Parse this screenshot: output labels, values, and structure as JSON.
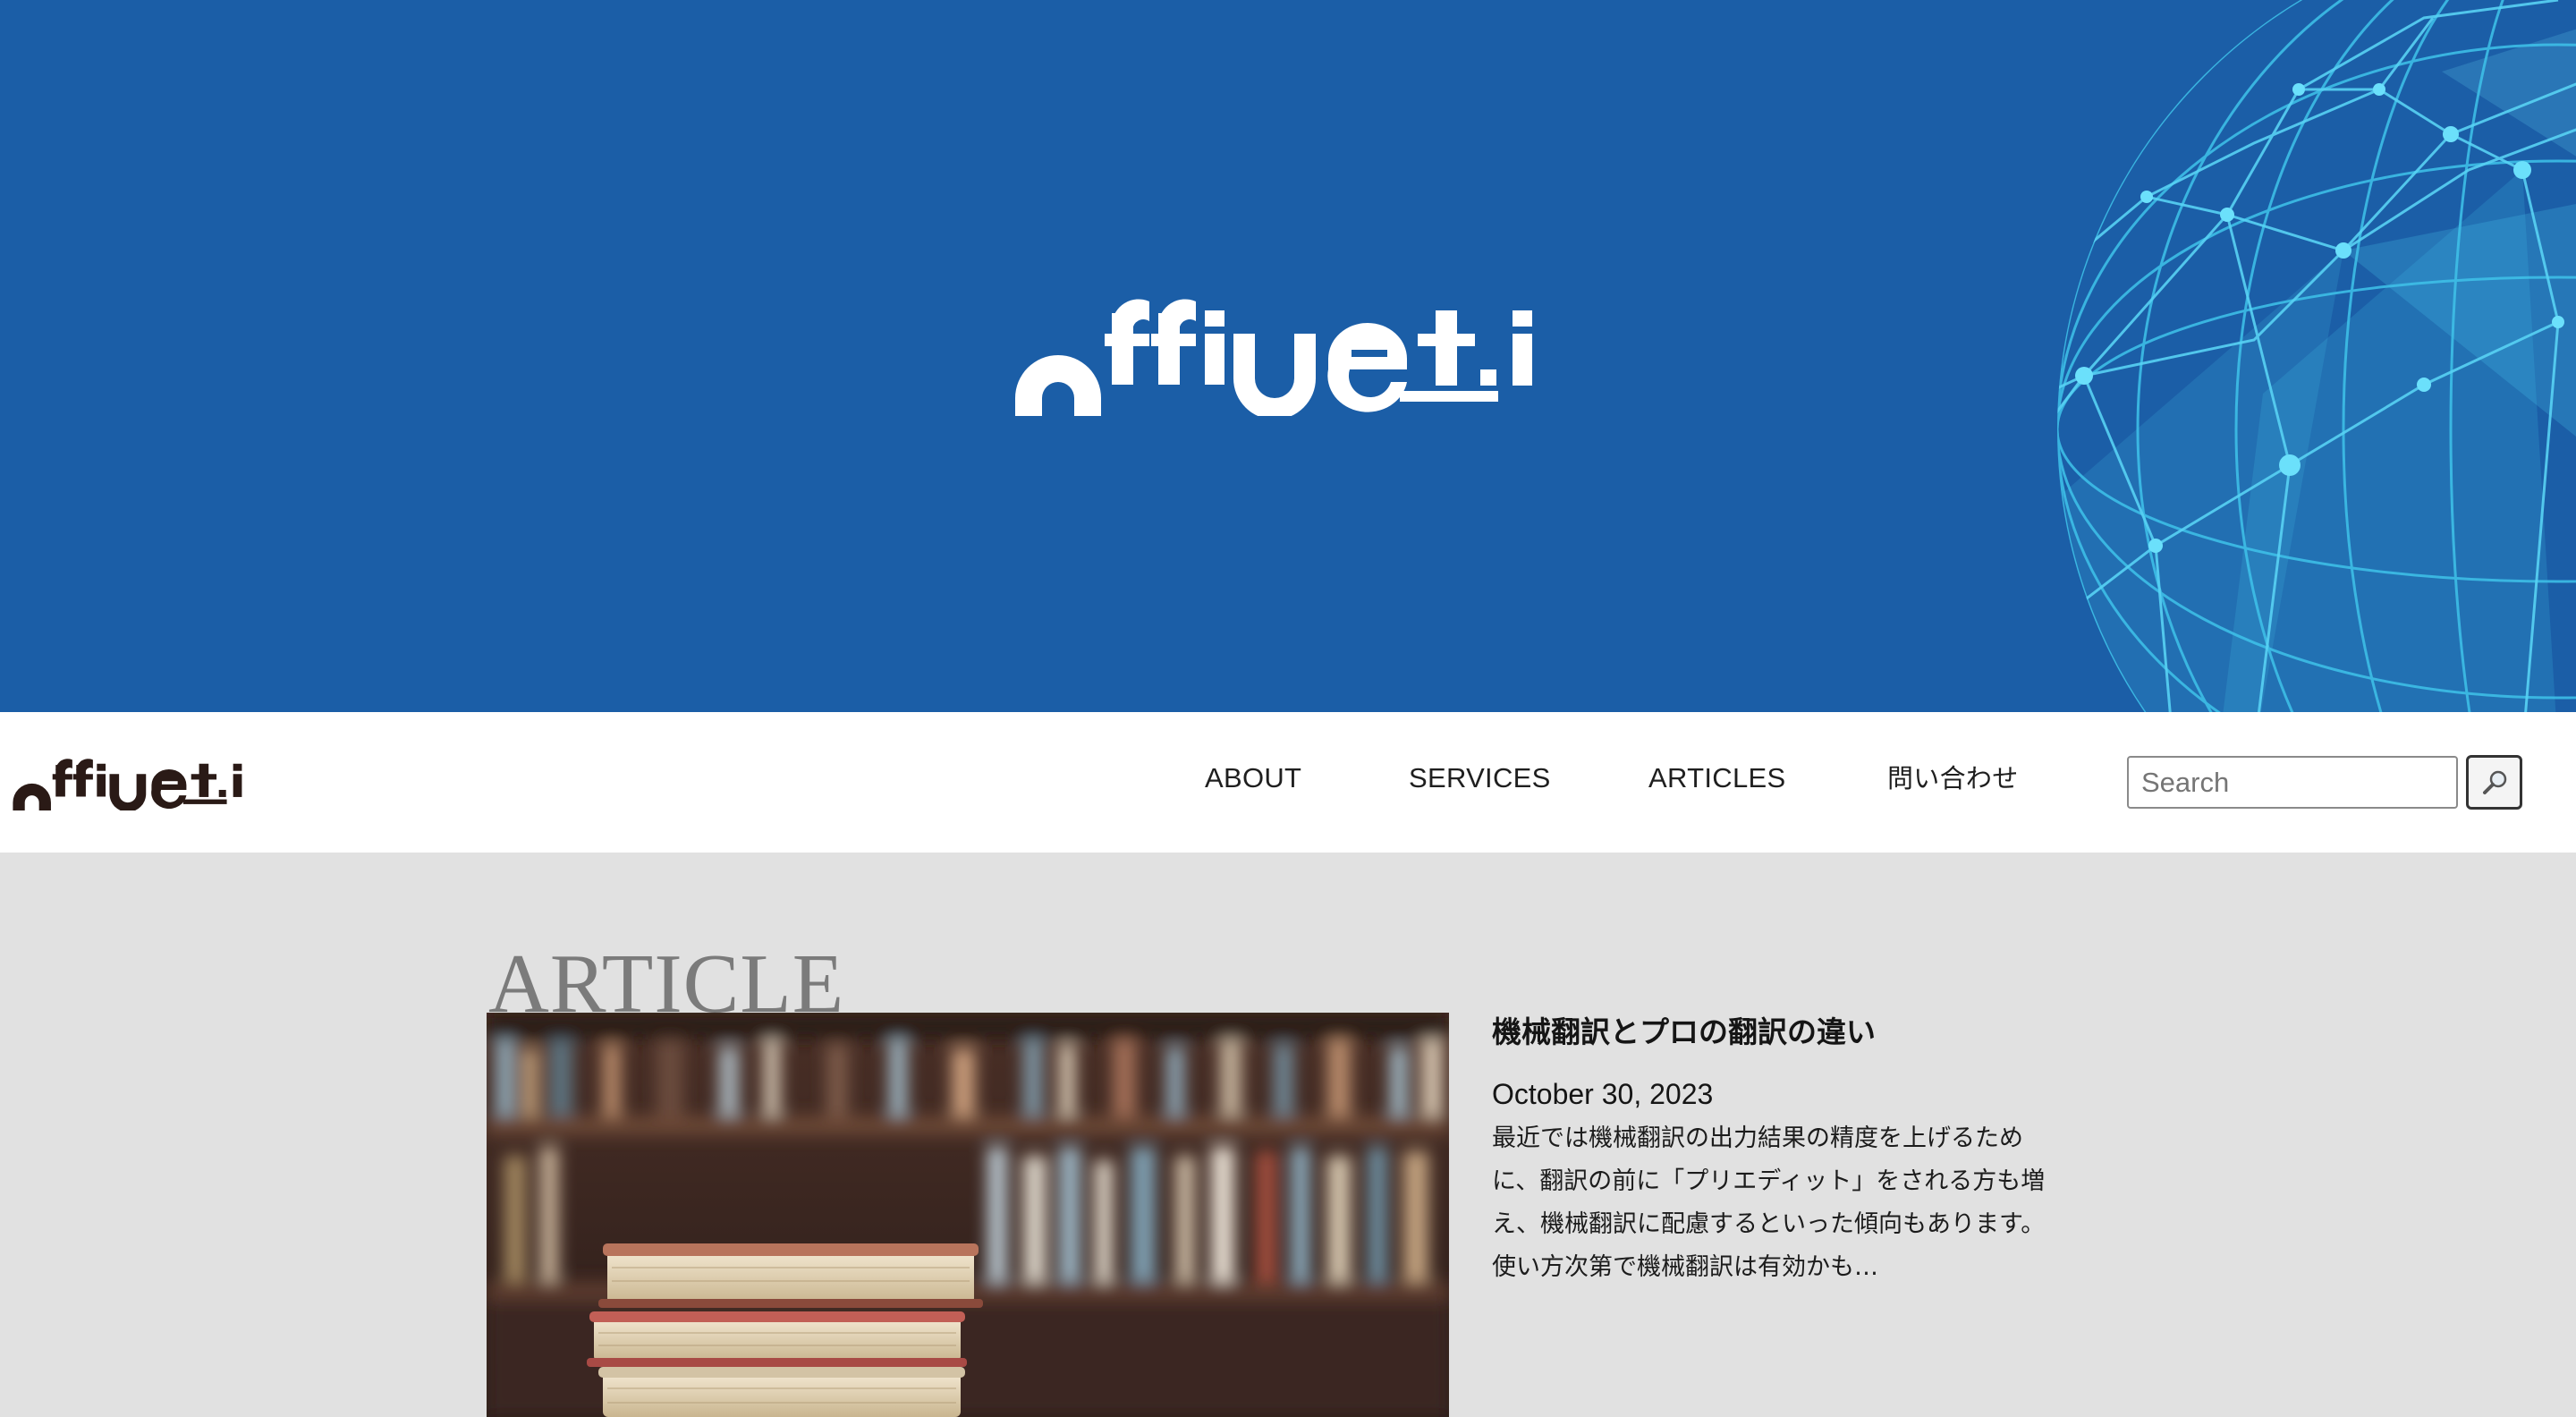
{
  "hero": {
    "background": "#1b5ea7",
    "logo_text": "office-t.i",
    "globe_color": "#3fc3ea"
  },
  "nav": {
    "logo_text": "office-t.i",
    "links": [
      {
        "label": "ABOUT"
      },
      {
        "label": "SERVICES"
      },
      {
        "label": "ARTICLES"
      },
      {
        "label": "問い合わせ"
      }
    ],
    "search": {
      "placeholder": "Search",
      "value": "",
      "button_icon": "magnifier-icon"
    }
  },
  "main": {
    "section_heading": "ARTICLE",
    "articles": [
      {
        "image": "books-on-library-shelf-photo",
        "title": "機械翻訳とプロの翻訳の違い",
        "date": "October 30, 2023",
        "excerpt": "最近では機械翻訳の出力結果の精度を上げるために、翻訳の前に「プリエディット」をされる方も増え、機械翻訳に配慮するといった傾向もあります。使い方次第で機械翻訳は有効かも…"
      }
    ]
  },
  "colors": {
    "page_background": "#e1e1e1",
    "navbar_background": "#ffffff",
    "heading_gray": "#7b7b7b",
    "logo_dark": "#2a1a16"
  }
}
